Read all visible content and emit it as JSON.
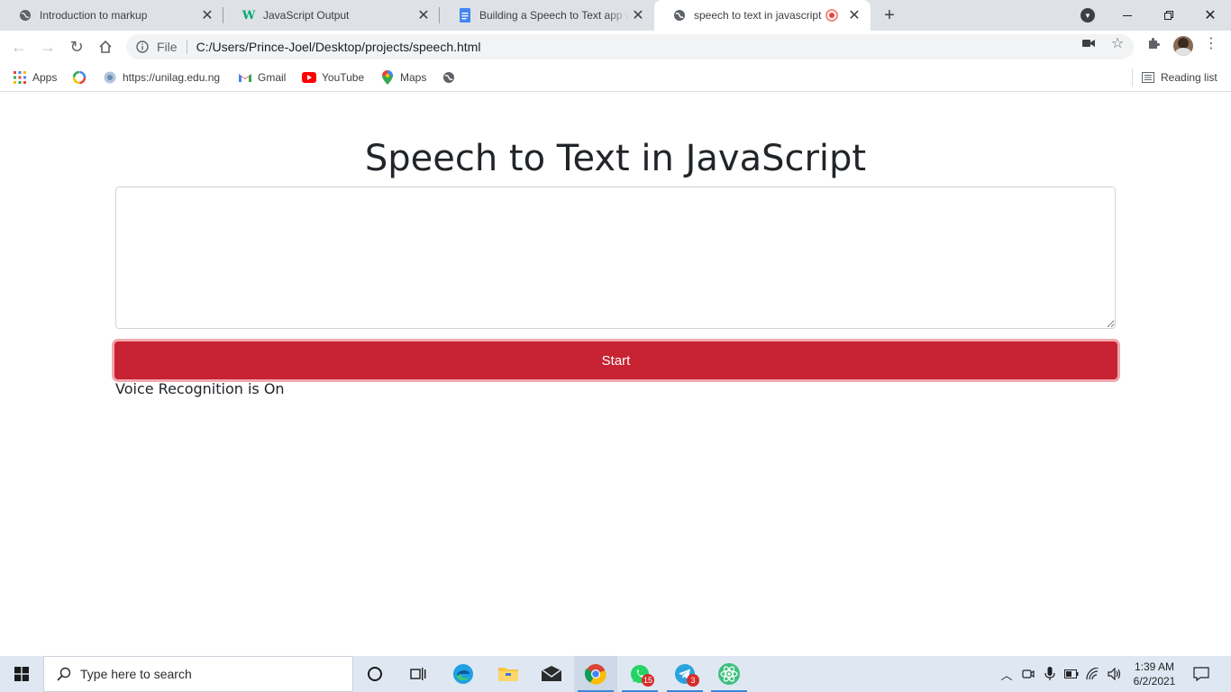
{
  "browser": {
    "tabs": [
      {
        "title": "Introduction to markup",
        "favicon": "globe-icon"
      },
      {
        "title": "JavaScript Output",
        "favicon": "w3-icon"
      },
      {
        "title": "Building a Speech to Text app wi",
        "favicon": "docs-icon"
      },
      {
        "title": "speech to text in javascript",
        "favicon": "globe-icon",
        "recording": true
      }
    ],
    "address": {
      "scheme_label": "File",
      "url": "C:/Users/Prince-Joel/Desktop/projects/speech.html"
    },
    "bookmarks": [
      {
        "label": "Apps",
        "icon": "apps-grid-icon"
      },
      {
        "label": "",
        "icon": "colorful-ring-icon"
      },
      {
        "label": "https://unilag.edu.ng",
        "icon": "unilag-icon"
      },
      {
        "label": "Gmail",
        "icon": "gmail-icon"
      },
      {
        "label": "YouTube",
        "icon": "youtube-icon"
      },
      {
        "label": "Maps",
        "icon": "maps-icon"
      },
      {
        "label": "",
        "icon": "globe-icon"
      }
    ],
    "reading_list_label": "Reading list"
  },
  "page": {
    "heading": "Speech to Text in JavaScript",
    "textarea_value": "",
    "start_button_label": "Start",
    "status_text": "Voice Recognition is On"
  },
  "taskbar": {
    "search_placeholder": "Type here to search",
    "whatsapp_badge": "15",
    "telegram_badge": "3",
    "clock_time": "1:39 AM",
    "clock_date": "6/2/2021"
  },
  "colors": {
    "start_button": "#c82333",
    "tabstrip": "#dee1e6",
    "taskbar": "#dfe8f2"
  }
}
